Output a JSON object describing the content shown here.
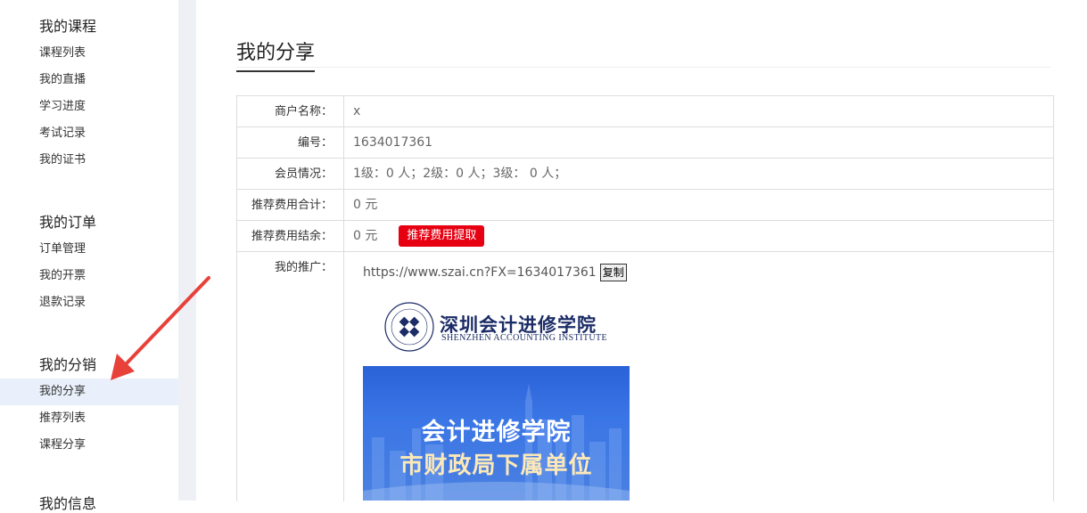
{
  "sidebar": {
    "sections": [
      {
        "title": "我的课程",
        "items": [
          "课程列表",
          "我的直播",
          "学习进度",
          "考试记录",
          "我的证书"
        ]
      },
      {
        "title": "我的订单",
        "items": [
          "订单管理",
          "我的开票",
          "退款记录"
        ]
      },
      {
        "title": "我的分销",
        "items": [
          "我的分享",
          "推荐列表",
          "课程分享"
        ]
      },
      {
        "title": "我的信息"
      }
    ],
    "active_item": "我的分享"
  },
  "main": {
    "title": "我的分享",
    "rows": {
      "merchant_label": "商户名称：",
      "merchant_value": "x",
      "id_label": "编号：",
      "id_value": "1634017361",
      "members_label": "会员情况：",
      "members_value": "1级：0 人；2级：0 人；3级： 0 人；",
      "total_label": "推荐费用合计：",
      "total_value": "0 元",
      "balance_label": "推荐费用结余：",
      "balance_value": "0 元",
      "withdraw_label": "推荐费用提取",
      "promo_label": "我的推广："
    },
    "promo": {
      "url": "https://www.szai.cn?FX=1634017361",
      "copy_label": "复制",
      "logo_cn": "深圳会计进修学院",
      "logo_en": "SHENZHEN ACCOUNTING INSTITUTE",
      "banner_line1": "会计进修学院",
      "banner_line2": "市财政局下属单位"
    }
  },
  "colors": {
    "accent_red": "#e60012",
    "active_bg": "#e9f0fb",
    "arrow_red": "#e8413a",
    "logo_navy": "#1b2c66"
  }
}
